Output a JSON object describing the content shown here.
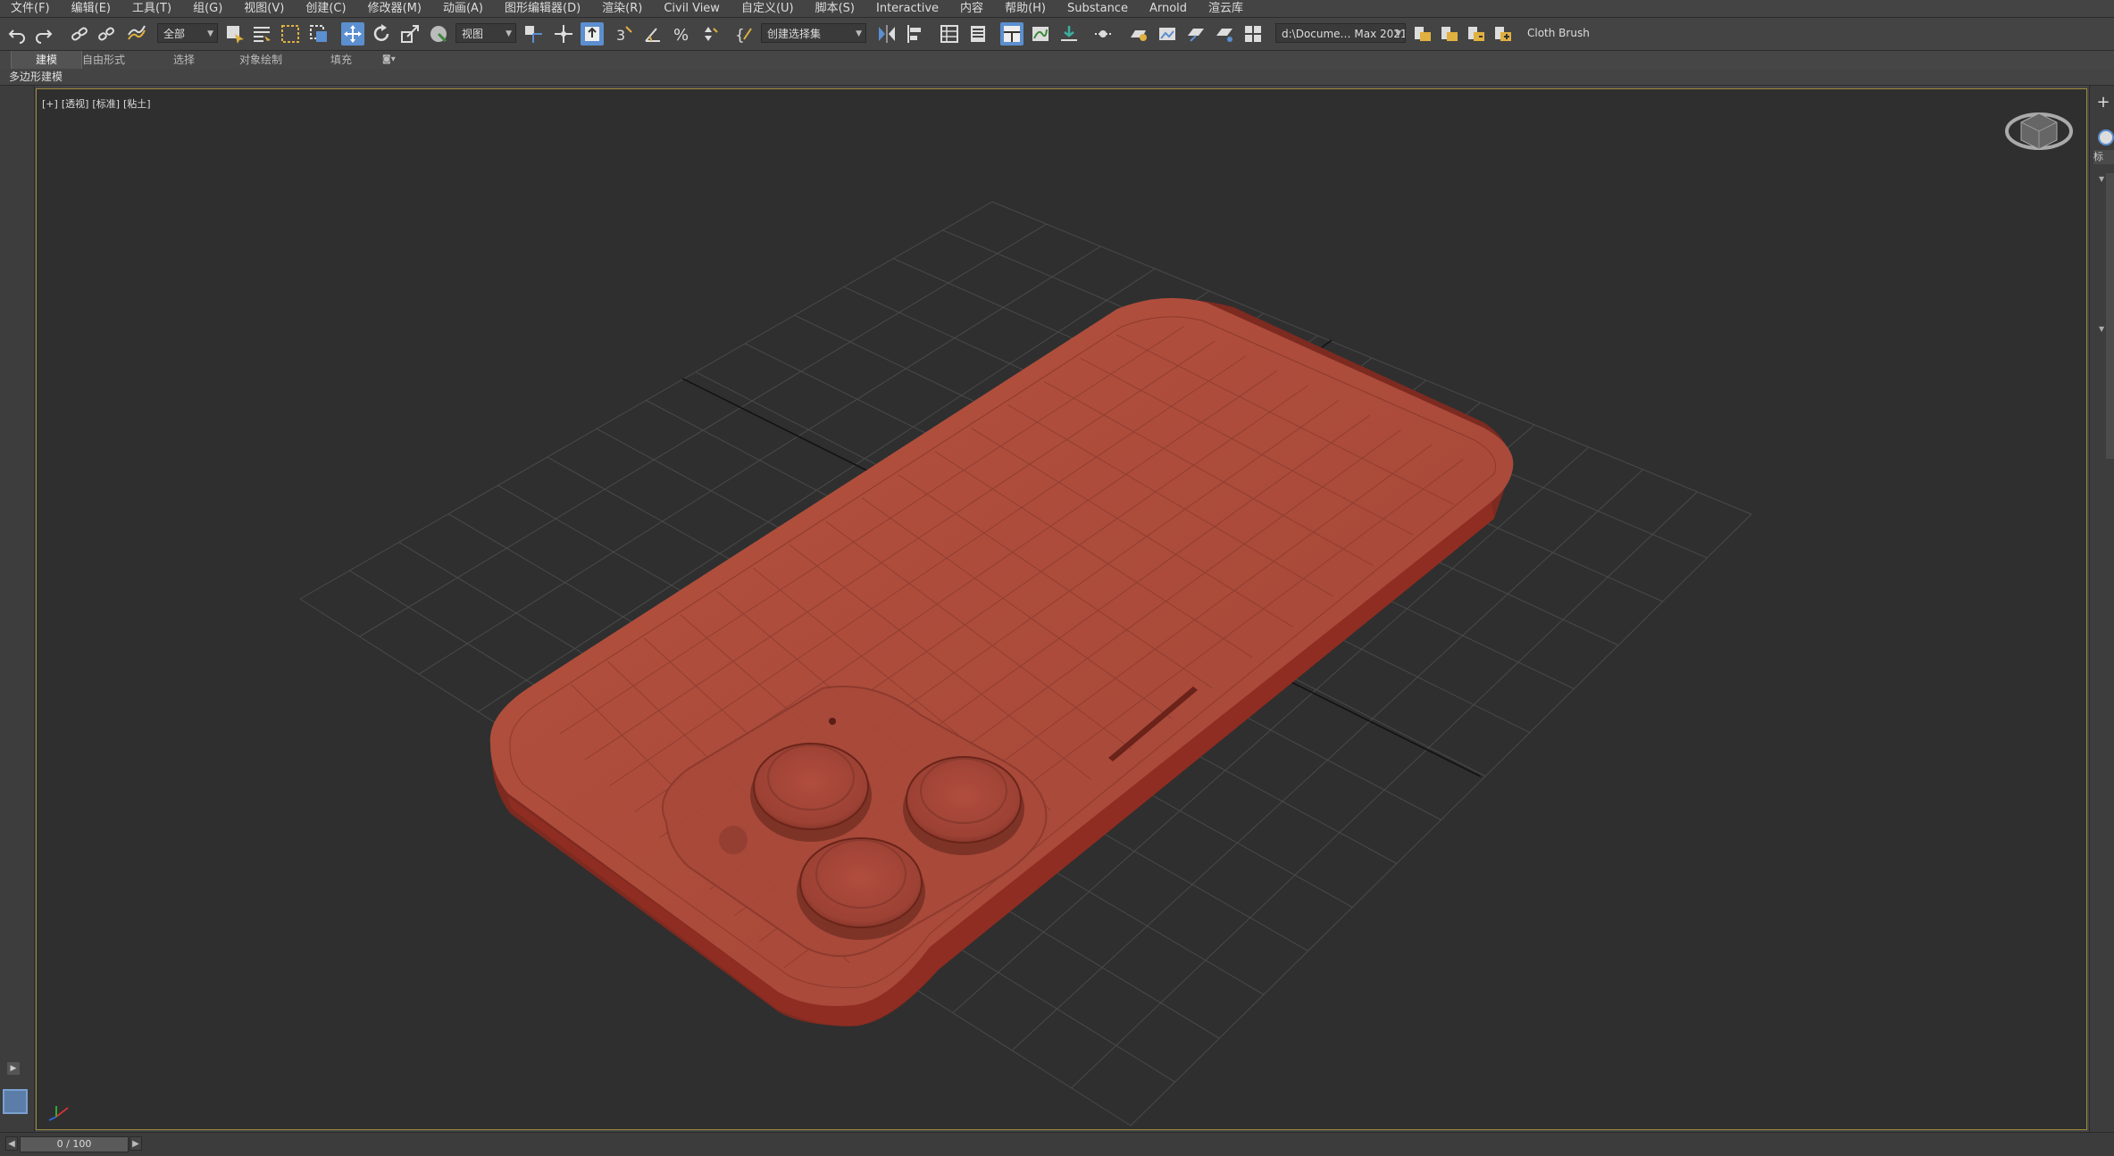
{
  "menu": [
    "文件(F)",
    "编辑(E)",
    "工具(T)",
    "组(G)",
    "视图(V)",
    "创建(C)",
    "修改器(M)",
    "动画(A)",
    "图形编辑器(D)",
    "渲染(R)",
    "Civil View",
    "自定义(U)",
    "脚本(S)",
    "Interactive",
    "内容",
    "帮助(H)",
    "Substance",
    "Arnold",
    "渲云库"
  ],
  "toolbar": {
    "selection_filter": "全部",
    "coord_system": "视图",
    "named_selection": "创建选择集",
    "project_path": "d:\\Docume… Max 2021",
    "brush_label": "Cloth Brush"
  },
  "ribbon": {
    "tabs": [
      "建模",
      "自由形式",
      "选择",
      "对象绘制",
      "填充"
    ],
    "active_tab": 0,
    "sub_label": "多边形建模"
  },
  "viewport": {
    "labels": [
      "[+]",
      "[透视]",
      "[标准]",
      "[粘土]"
    ],
    "model_color": "#a4483d",
    "grid_color": "#4a4a4a"
  },
  "timeline": {
    "frame_display": "0 / 100"
  },
  "right_panel": {
    "label": "标"
  },
  "colors": {
    "ui_bg": "#444444",
    "viewport_bg": "#2f2f2f",
    "viewport_border": "#a08a3c",
    "active_button": "#5b8fcf"
  }
}
